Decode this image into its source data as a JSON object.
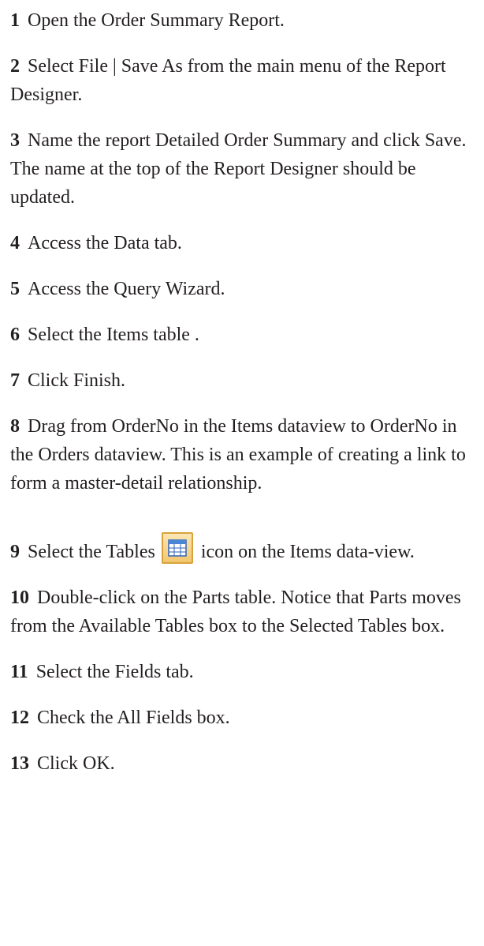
{
  "steps": [
    {
      "num": "1",
      "text": "Open the Order Summary Report."
    },
    {
      "num": "2",
      "text": "Select File | Save As from the main menu of the Report Designer."
    },
    {
      "num": "3",
      "text": "Name the report Detailed Order Summary and click Save. The name at the top of the Report Designer should be updated."
    },
    {
      "num": "4",
      "text": "Access the Data tab."
    },
    {
      "num": "5",
      "text": "Access the Query Wizard."
    },
    {
      "num": "6",
      "text": "Select the Items table ."
    },
    {
      "num": "7",
      "text": "Click Finish."
    },
    {
      "num": "8",
      "text": "Drag from OrderNo in the Items dataview to OrderNo in the Orders dataview.  This is an example of creating a link to form a master-detail relationship."
    },
    {
      "num": "9",
      "text_before": "Select the Tables",
      "text_after": "icon on the Items data-view.",
      "icon": "tables-icon"
    },
    {
      "num": "10",
      "text": "Double-click on the Parts table.  Notice that Parts moves from the Available Tables box to the Selected Tables box."
    },
    {
      "num": "11",
      "text": "Select the Fields tab."
    },
    {
      "num": "12",
      "text": "Check the All Fields box."
    },
    {
      "num": "13",
      "text": "Click OK."
    }
  ]
}
